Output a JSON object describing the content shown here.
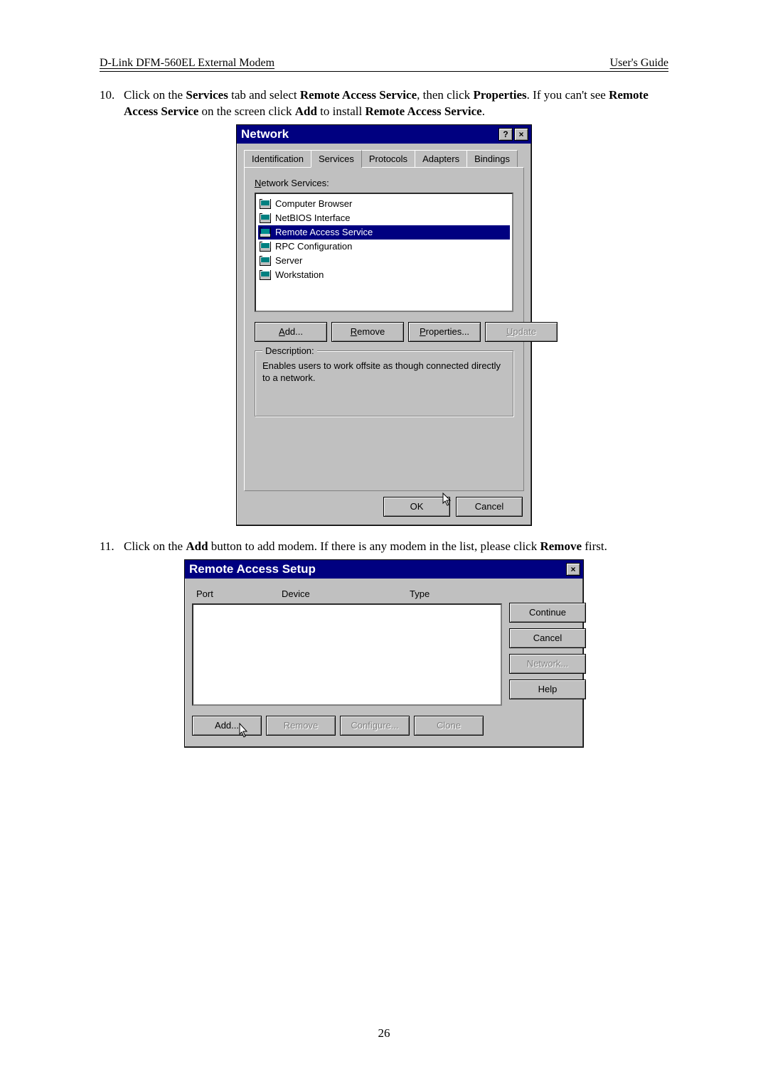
{
  "header": {
    "left": "D-Link DFM-560EL External Modem",
    "right": "User's Guide"
  },
  "step10": {
    "num": "10.",
    "t1": "Click on the ",
    "b1": "Services",
    "t2": " tab and select ",
    "b2": "Remote Access Service",
    "t3": ", then click ",
    "b3": "Properties",
    "t4": ". If you can't see ",
    "b4": "Remote Access Service",
    "t5": " on the screen click ",
    "b5": "Add",
    "t6": " to install ",
    "b6": "Remote Access Service",
    "t7": "."
  },
  "dlg1": {
    "title": "Network",
    "tabs": [
      "Identification",
      "Services",
      "Protocols",
      "Adapters",
      "Bindings"
    ],
    "listlabel_pre": "N",
    "listlabel_post": "etwork Services:",
    "services": [
      "Computer Browser",
      "NetBIOS Interface",
      "Remote Access Service",
      "RPC Configuration",
      "Server",
      "Workstation"
    ],
    "selected_index": 2,
    "buttons": {
      "add": "Add...",
      "remove": "Remove",
      "properties": "Properties...",
      "update": "Update"
    },
    "groupbox": {
      "title": "Description:",
      "text": "Enables users to work offsite as though connected directly to a network."
    },
    "ok": "OK",
    "cancel": "Cancel"
  },
  "step11": {
    "num": "11.",
    "t1": "Click on the ",
    "b1": "Add",
    "t2": " button to add modem. If there is any modem in the list, please click ",
    "b2": "Remove",
    "t3": " first."
  },
  "dlg2": {
    "title": "Remote Access Setup",
    "cols": {
      "port": "Port",
      "device": "Device",
      "type": "Type"
    },
    "right": {
      "continue": "Continue",
      "cancel": "Cancel",
      "network": "Network...",
      "help": "Help"
    },
    "bottom": {
      "add": "Add...",
      "remove": "Remove",
      "configure": "Configure...",
      "clone": "Clone"
    }
  },
  "page_number": "26"
}
